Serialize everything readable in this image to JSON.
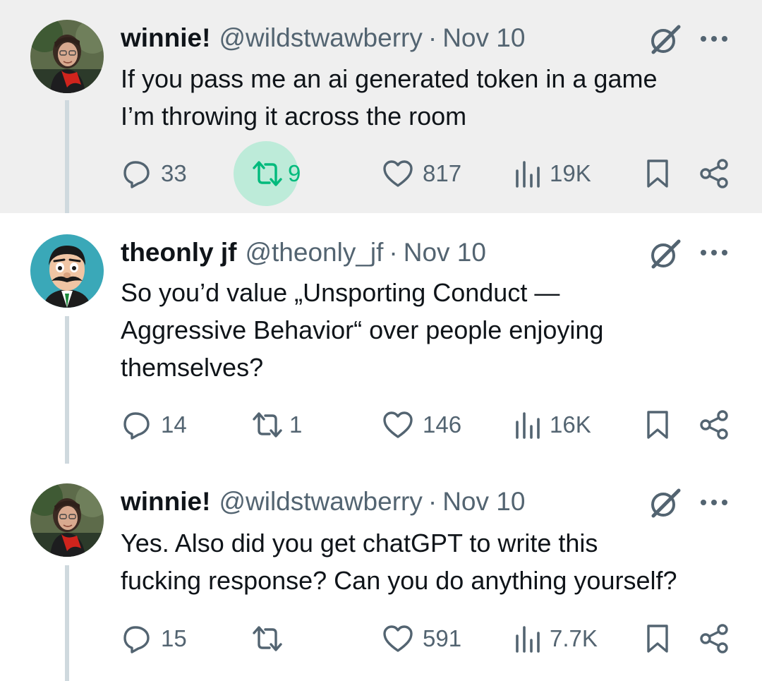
{
  "tweets": [
    {
      "name": "winnie!",
      "handle": "@wildstwawberry",
      "separator": "·",
      "date": "Nov 10",
      "text_lines": [
        "If you pass me an ai generated token in a game",
        "I’m throwing it across the room"
      ],
      "replies": "33",
      "reposts": "9",
      "likes": "817",
      "views": "19K",
      "repost_active": true,
      "highlighted": true
    },
    {
      "name": "theonly jf",
      "handle": "@theonly_jf",
      "separator": "·",
      "date": "Nov 10",
      "text_lines": [
        "So you’d value „Unsporting Conduct —",
        "Aggressive Behavior“ over people enjoying",
        "themselves?"
      ],
      "replies": "14",
      "reposts": "1",
      "likes": "146",
      "views": "16K",
      "repost_active": false,
      "highlighted": false
    },
    {
      "name": "winnie!",
      "handle": "@wildstwawberry",
      "separator": "·",
      "date": "Nov 10",
      "text_lines": [
        "Yes. Also did you get chatGPT to write this",
        "fucking response? Can you do anything yourself?"
      ],
      "replies": "15",
      "reposts": "",
      "likes": "591",
      "views": "7.7K",
      "repost_active": false,
      "highlighted": false
    }
  ],
  "colors": {
    "highlight_bg": "#efefef",
    "text_primary": "#0f1419",
    "text_secondary": "#536471",
    "repost_green": "#00ba7c",
    "thread_line": "#cfd9de"
  },
  "icons": [
    "reply-icon",
    "repost-icon",
    "like-icon",
    "views-icon",
    "bookmark-icon",
    "share-icon",
    "grok-icon",
    "more-icon"
  ]
}
